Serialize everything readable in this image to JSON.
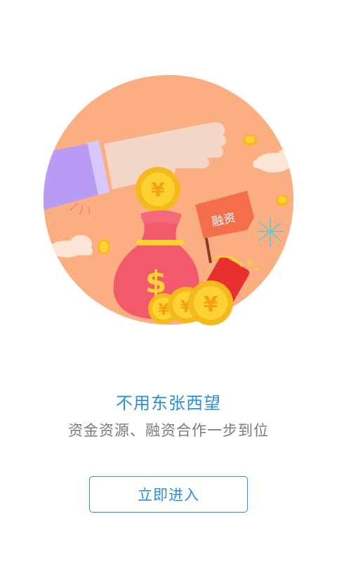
{
  "splash": {
    "flag_text": "融资",
    "coin_symbol": "¥",
    "bag_symbol": "$",
    "title": "不用东张西望",
    "subtitle": "资金资源、融资合作一步到位",
    "enter_button": "立即进入"
  },
  "colors": {
    "accent": "#2b8fd6",
    "circle": "#fcae83",
    "bag": "#f25a6c",
    "coin": "#ffd233",
    "flag": "#f56e4c",
    "sleeve": "#b79bf5"
  }
}
